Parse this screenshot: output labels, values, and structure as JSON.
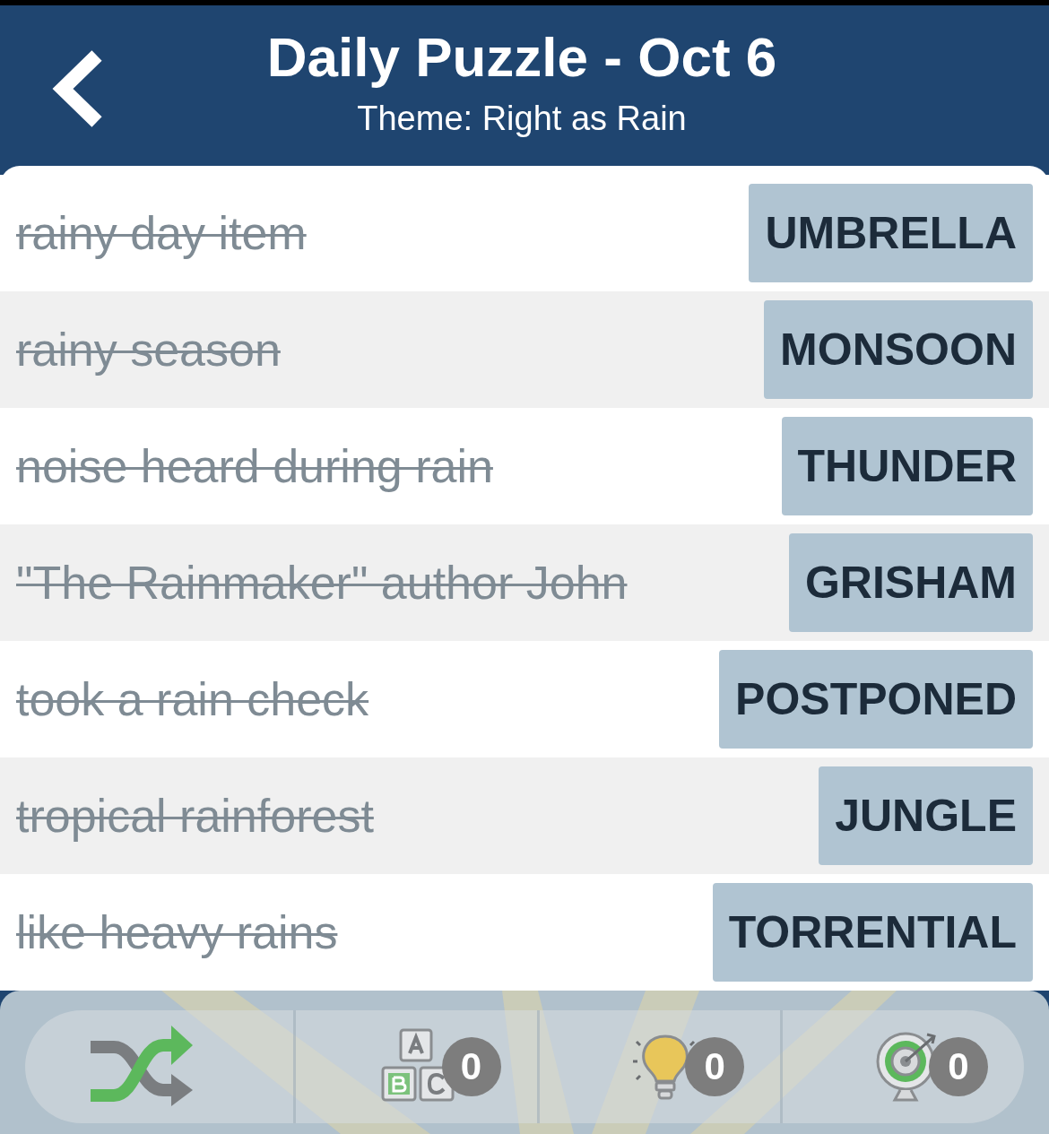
{
  "header": {
    "title": "Daily Puzzle - Oct 6",
    "subtitle": "Theme: Right as Rain"
  },
  "clues": [
    {
      "clue": "rainy day item",
      "answer": "UMBRELLA",
      "solved": true
    },
    {
      "clue": "rainy season",
      "answer": "MONSOON",
      "solved": true
    },
    {
      "clue": "noise heard during rain",
      "answer": "THUNDER",
      "solved": true
    },
    {
      "clue": "\"The Rainmaker\" author John",
      "answer": "GRISHAM",
      "solved": true
    },
    {
      "clue": "took a rain check",
      "answer": "POSTPONED",
      "solved": true
    },
    {
      "clue": "tropical rainforest",
      "answer": "JUNGLE",
      "solved": true
    },
    {
      "clue": "like heavy rains",
      "answer": "TORRENTIAL",
      "solved": true
    }
  ],
  "toolbar": [
    {
      "kind": "shuffle"
    },
    {
      "kind": "letters",
      "count": "0"
    },
    {
      "kind": "hint",
      "count": "0"
    },
    {
      "kind": "target",
      "count": "0"
    }
  ]
}
